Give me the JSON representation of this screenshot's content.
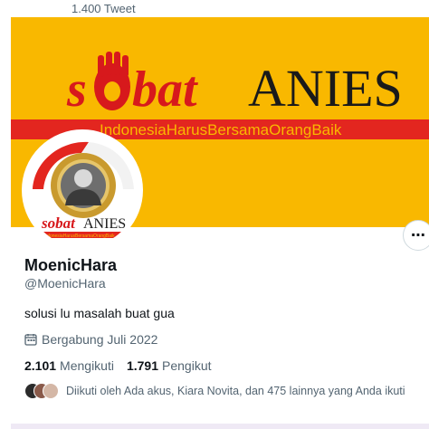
{
  "header": {
    "tweet_count": "1.400 Tweet"
  },
  "banner": {
    "logo_text_script": "sobat",
    "logo_text_caps": "ANIES",
    "tagline": "IndonesiaHarusBersamaOrangBaik",
    "colors": {
      "background": "#f9b800",
      "text": "#d7191c",
      "caps": "#1a1a1a",
      "stripe": "#e3261f"
    }
  },
  "avatar": {
    "logo_text_script": "sobat",
    "logo_text_caps": "ANIES",
    "tagline": "IndonesiaHarusBersamaOrangBaik"
  },
  "profile": {
    "name": "MoenicHara",
    "handle": "@MoenicHara",
    "bio": "solusi lu masalah buat gua",
    "joined": "Bergabung Juli 2022",
    "following_count": "2.101",
    "following_label": "Mengikuti",
    "followers_count": "1.791",
    "followers_label": "Pengikut",
    "followed_by": "Diikuti oleh Ada akus, Kiara Novita, dan 475 lainnya yang Anda ikuti"
  },
  "icons": {
    "more": "more-horizontal-icon",
    "calendar": "calendar-icon"
  }
}
